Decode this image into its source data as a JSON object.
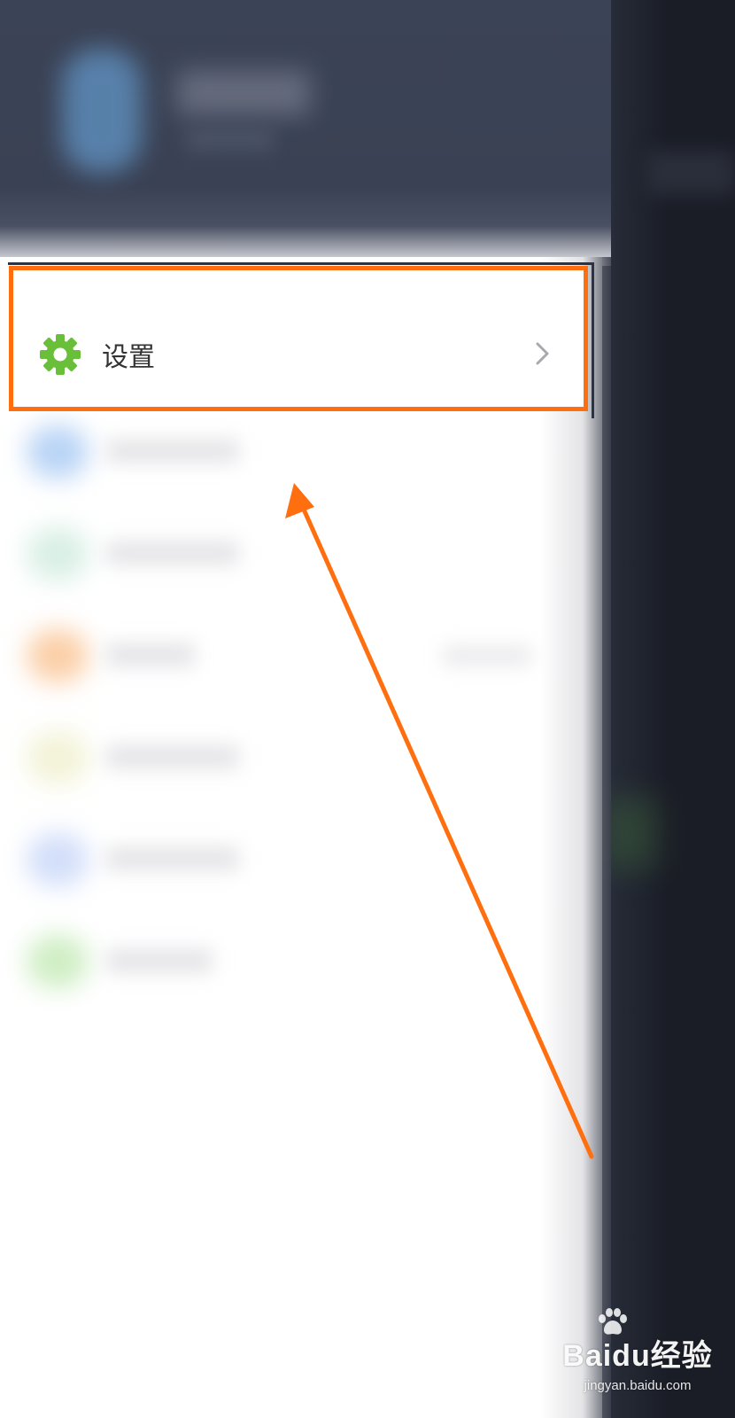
{
  "settings_item": {
    "label": "设置"
  },
  "icons": {
    "settings": "gear-icon",
    "chevron": "chevron-right-icon",
    "paw": "paw-icon"
  },
  "colors": {
    "gear": "#6abf3a",
    "highlight": "#ff6e0f",
    "chevron": "#a8a8ad"
  },
  "watermark": {
    "logo": "Baidu经验",
    "url": "jingyan.baidu.com"
  }
}
